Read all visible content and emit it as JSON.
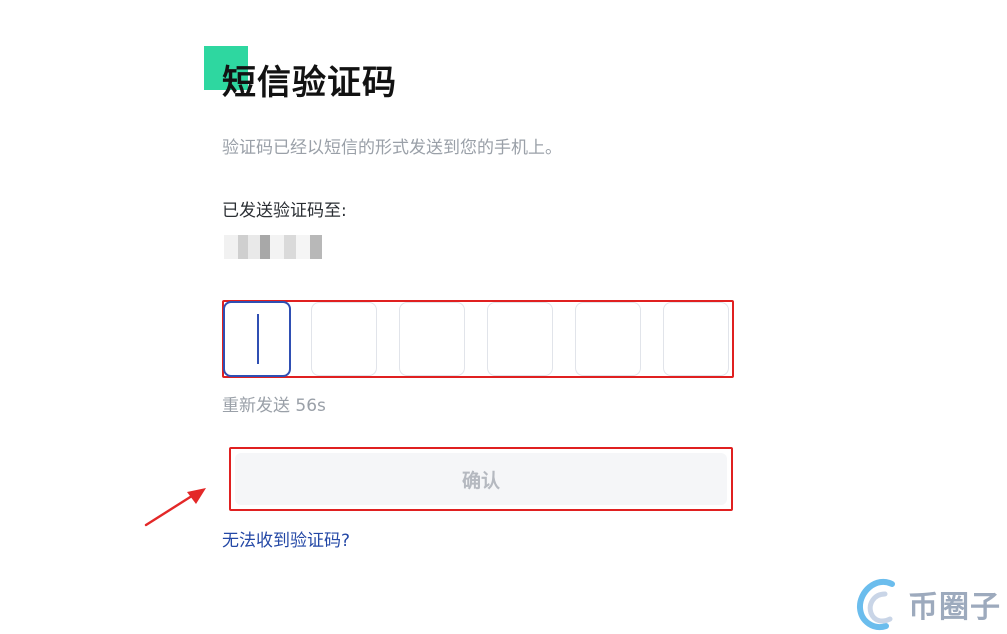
{
  "header": {
    "title": "短信验证码"
  },
  "message": {
    "subtitle": "验证码已经以短信的形式发送到您的手机上。",
    "sent_label": "已发送验证码至:"
  },
  "code_input": {
    "digits": [
      "",
      "",
      "",
      "",
      "",
      ""
    ]
  },
  "resend": {
    "label": "重新发送 56s"
  },
  "actions": {
    "confirm_label": "确认",
    "help_link": "无法收到验证码?"
  },
  "watermark": {
    "text": "币圈子",
    "icon": "watermark-logo-icon"
  },
  "colors": {
    "accent": "#2ed7a0",
    "highlight": "#e02020",
    "link": "#2448a6",
    "active_input": "#2f4fb3"
  }
}
